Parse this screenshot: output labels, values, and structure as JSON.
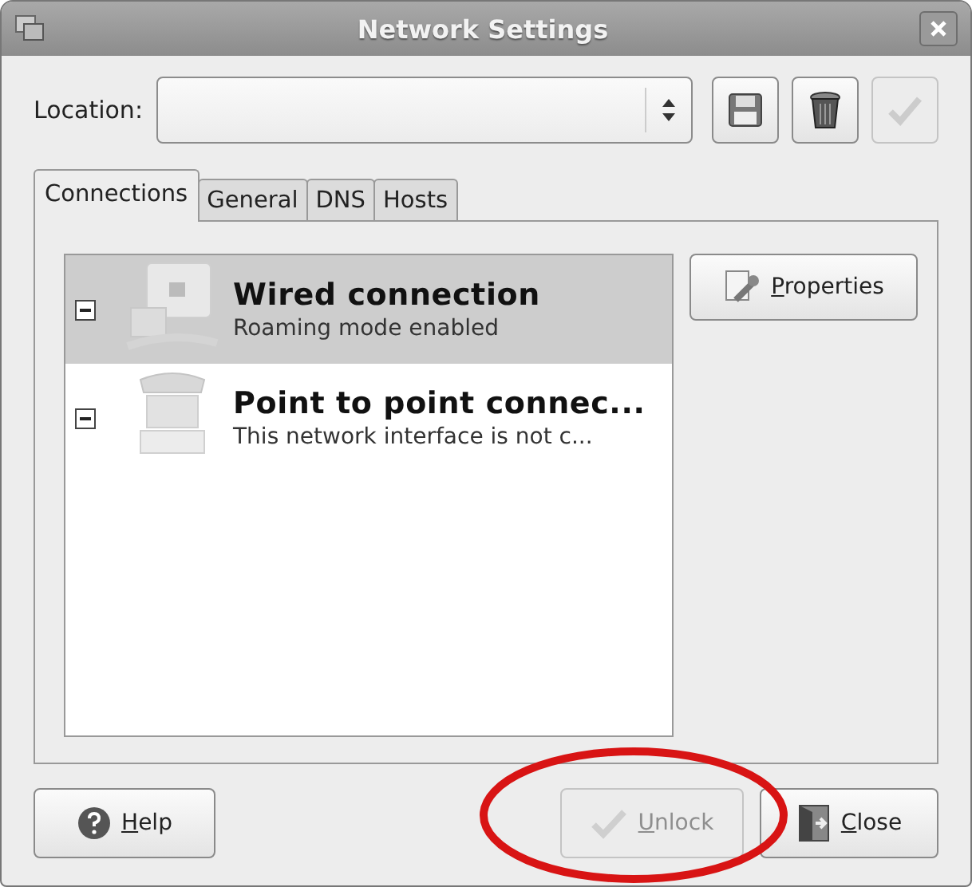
{
  "window": {
    "title": "Network Settings"
  },
  "location": {
    "label": "Location:"
  },
  "toolbar": [
    {
      "kind": "save",
      "disabled": false
    },
    {
      "kind": "delete",
      "disabled": false
    },
    {
      "kind": "apply",
      "disabled": true
    }
  ],
  "tabs": [
    {
      "label": "Connections",
      "selected": true
    },
    {
      "label": "General",
      "selected": false
    },
    {
      "label": "DNS",
      "selected": false
    },
    {
      "label": "Hosts",
      "selected": false
    }
  ],
  "connections": [
    {
      "kind": "wired",
      "title": "Wired connection",
      "subtitle": "Roaming mode enabled",
      "selected": true
    },
    {
      "kind": "modem",
      "title": "Point to point connec...",
      "subtitle": "This network interface is not c...",
      "selected": false
    }
  ],
  "properties_button": {
    "label": "Properties"
  },
  "buttons": [
    {
      "kind": "help",
      "label": "Help",
      "disabled": false
    },
    {
      "kind": "unlock",
      "label": "Unlock",
      "disabled": true
    },
    {
      "kind": "close",
      "label": "Close",
      "disabled": false
    }
  ],
  "highlight": {
    "color": "#d81414"
  }
}
